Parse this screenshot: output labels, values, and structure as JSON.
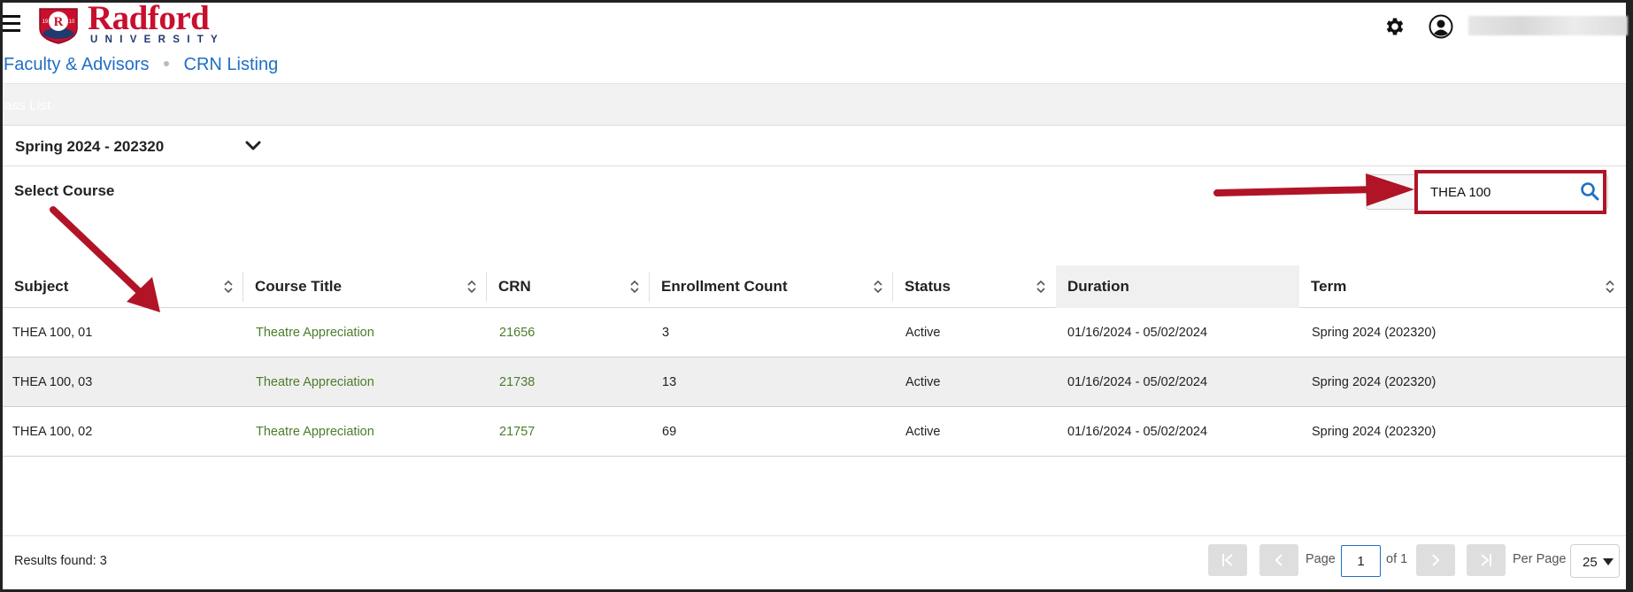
{
  "header": {
    "logo_text": "Radford",
    "logo_subtext": "UNIVERSITY",
    "seal_text": "R",
    "seal_year_left": "19",
    "seal_year_right": "10",
    "brand_color": "#c8102e"
  },
  "breadcrumb": {
    "items": [
      "Faculty & Advisors",
      "CRN Listing"
    ]
  },
  "band": {
    "title": "ass List"
  },
  "term": {
    "selected": "Spring 2024 - 202320"
  },
  "select_course": {
    "label": "Select Course"
  },
  "search": {
    "value": "THEA 100"
  },
  "table": {
    "columns": [
      "Subject",
      "Course Title",
      "CRN",
      "Enrollment Count",
      "Status",
      "Duration",
      "Term"
    ],
    "rows": [
      {
        "subject": "THEA 100, 01",
        "title": "Theatre Appreciation",
        "crn": "21656",
        "enrollment": "3",
        "status": "Active",
        "duration": "01/16/2024 - 05/02/2024",
        "term": "Spring 2024 (202320)"
      },
      {
        "subject": "THEA 100, 03",
        "title": "Theatre Appreciation",
        "crn": "21738",
        "enrollment": "13",
        "status": "Active",
        "duration": "01/16/2024 - 05/02/2024",
        "term": "Spring 2024 (202320)"
      },
      {
        "subject": "THEA 100, 02",
        "title": "Theatre Appreciation",
        "crn": "21757",
        "enrollment": "69",
        "status": "Active",
        "duration": "01/16/2024 - 05/02/2024",
        "term": "Spring 2024 (202320)"
      }
    ]
  },
  "footer": {
    "results": "Results found: 3",
    "page_label": "Page",
    "page_value": "1",
    "of_label": "of 1",
    "per_page_label": "Per Page",
    "per_page_value": "25"
  },
  "icons": {
    "menu": "hamburger-icon",
    "settings": "gear-icon",
    "user": "user-icon",
    "search": "search-icon",
    "sort": "sort-icon",
    "chevron": "chevron-down-icon"
  },
  "colors": {
    "link_blue": "#1f6fc5",
    "link_green": "#4b7d2b",
    "annotation_red": "#b11427"
  }
}
